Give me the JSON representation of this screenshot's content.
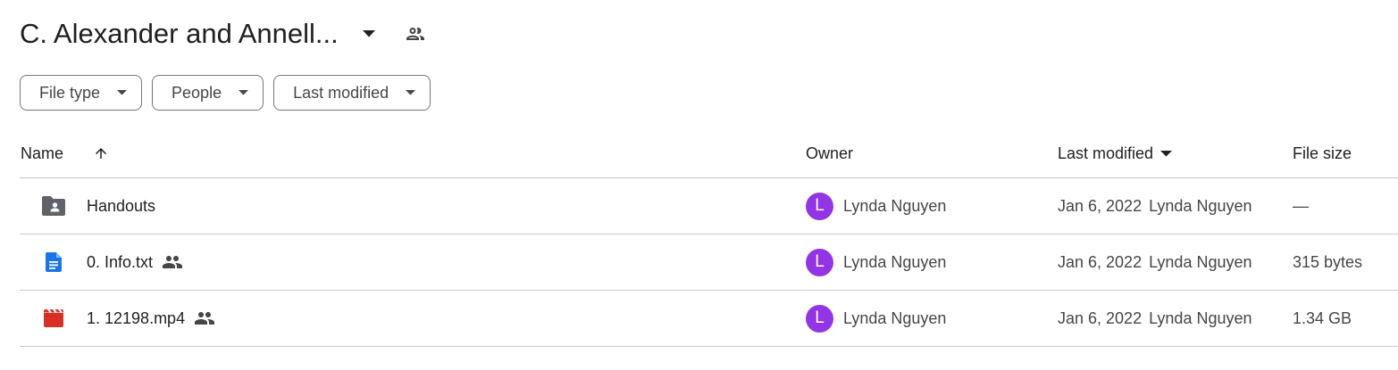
{
  "header": {
    "title": "C. Alexander and Annell...",
    "title_dropdown_icon": "arrow-drop-down-icon",
    "shared_icon": "people-icon"
  },
  "filters": [
    {
      "label": "File type",
      "icon": "arrow-drop-down-icon"
    },
    {
      "label": "People",
      "icon": "arrow-drop-down-icon"
    },
    {
      "label": "Last modified",
      "icon": "arrow-drop-down-icon"
    }
  ],
  "table": {
    "columns": {
      "name": "Name",
      "owner": "Owner",
      "last_modified": "Last modified",
      "file_size": "File size"
    },
    "sort_icon": "arrow-upward-icon",
    "rows": [
      {
        "icon": "shared-folder-icon",
        "name": "Handouts",
        "shared": false,
        "owner_initial": "L",
        "owner": "Lynda Nguyen",
        "modified_date": "Jan 6, 2022",
        "modified_by": "Lynda Nguyen",
        "size": "—"
      },
      {
        "icon": "google-docs-icon",
        "name": "0. Info.txt",
        "shared": true,
        "owner_initial": "L",
        "owner": "Lynda Nguyen",
        "modified_date": "Jan 6, 2022",
        "modified_by": "Lynda Nguyen",
        "size": "315 bytes"
      },
      {
        "icon": "video-file-icon",
        "name": "1. 12198.mp4",
        "shared": true,
        "owner_initial": "L",
        "owner": "Lynda Nguyen",
        "modified_date": "Jan 6, 2022",
        "modified_by": "Lynda Nguyen",
        "size": "1.34 GB"
      }
    ]
  },
  "colors": {
    "avatar": "#9334e6",
    "docs_blue": "#1a73e8",
    "video_red": "#d93025",
    "folder_gray": "#5f6368",
    "border": "#c7c7c7"
  }
}
